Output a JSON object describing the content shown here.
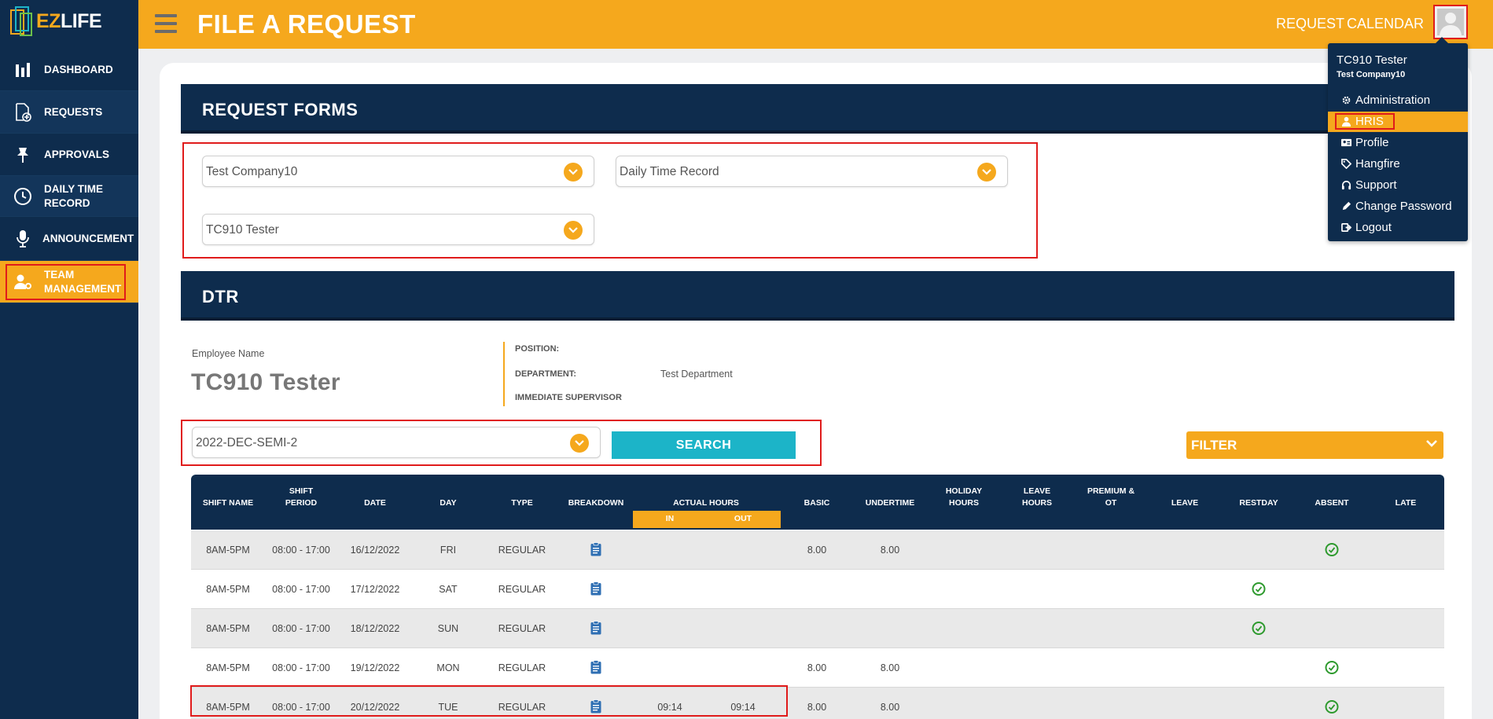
{
  "app": {
    "logo_ez": "EZ",
    "logo_life": "LIFE",
    "page_title": "FILE A REQUEST"
  },
  "sidebar": {
    "items": [
      {
        "label": "DASHBOARD",
        "icon": "bar-chart-icon"
      },
      {
        "label": "REQUESTS",
        "icon": "file-plus-icon"
      },
      {
        "label": "APPROVALS",
        "icon": "pin-icon"
      },
      {
        "label": "DAILY TIME RECORD",
        "icon": "clock-icon"
      },
      {
        "label": "ANNOUNCEMENT",
        "icon": "microphone-icon"
      },
      {
        "label": "TEAM MANAGEMENT",
        "icon": "user-gear-icon"
      }
    ]
  },
  "header": {
    "links": [
      "REQUEST",
      "CALENDAR"
    ]
  },
  "user_menu": {
    "name": "TC910 Tester",
    "company": "Test Company10",
    "items": [
      {
        "label": "Administration",
        "icon": "gear-icon"
      },
      {
        "label": "HRIS",
        "icon": "user-icon"
      },
      {
        "label": "Profile",
        "icon": "id-card-icon"
      },
      {
        "label": "Hangfire",
        "icon": "tags-icon"
      },
      {
        "label": "Support",
        "icon": "headset-icon"
      },
      {
        "label": "Change Password",
        "icon": "pencil-icon"
      },
      {
        "label": "Logout",
        "icon": "logout-icon"
      }
    ]
  },
  "request_forms": {
    "title": "REQUEST FORMS",
    "company_select": "Test Company10",
    "form_select": "Daily Time Record",
    "employee_select": "TC910 Tester"
  },
  "dtr": {
    "title": "DTR",
    "employee_label": "Employee Name",
    "employee_name": "TC910 Tester",
    "position_label": "POSITION:",
    "position_value": "",
    "department_label": "DEPARTMENT:",
    "department_value": "Test Department",
    "supervisor_label": "IMMEDIATE SUPERVISOR",
    "period_select": "2022-DEC-SEMI-2",
    "search_label": "SEARCH",
    "filter_label": "FILTER"
  },
  "table": {
    "headers": {
      "shift_name": "SHIFT NAME",
      "shift_period_1": "SHIFT",
      "shift_period_2": "PERIOD",
      "date": "DATE",
      "day": "DAY",
      "type": "TYPE",
      "breakdown": "BREAKDOWN",
      "actual_hours": "ACTUAL HOURS",
      "in": "IN",
      "out": "OUT",
      "basic": "BASIC",
      "undertime": "UNDERTIME",
      "holiday_1": "HOLIDAY",
      "holiday_2": "HOURS",
      "leave_hours_1": "LEAVE",
      "leave_hours_2": "HOURS",
      "premium_1": "PREMIUM &",
      "premium_2": "OT",
      "leave": "LEAVE",
      "restday": "RESTDAY",
      "absent": "ABSENT",
      "late": "LATE"
    },
    "rows": [
      {
        "shift_name": "8AM-5PM",
        "shift_period": "08:00 - 17:00",
        "date": "16/12/2022",
        "day": "FRI",
        "type": "REGULAR",
        "in": "",
        "out": "",
        "basic": "8.00",
        "undertime": "8.00",
        "restday": false,
        "absent": true
      },
      {
        "shift_name": "8AM-5PM",
        "shift_period": "08:00 - 17:00",
        "date": "17/12/2022",
        "day": "SAT",
        "type": "REGULAR",
        "in": "",
        "out": "",
        "basic": "",
        "undertime": "",
        "restday": true,
        "absent": false
      },
      {
        "shift_name": "8AM-5PM",
        "shift_period": "08:00 - 17:00",
        "date": "18/12/2022",
        "day": "SUN",
        "type": "REGULAR",
        "in": "",
        "out": "",
        "basic": "",
        "undertime": "",
        "restday": true,
        "absent": false
      },
      {
        "shift_name": "8AM-5PM",
        "shift_period": "08:00 - 17:00",
        "date": "19/12/2022",
        "day": "MON",
        "type": "REGULAR",
        "in": "",
        "out": "",
        "basic": "8.00",
        "undertime": "8.00",
        "restday": false,
        "absent": true
      },
      {
        "shift_name": "8AM-5PM",
        "shift_period": "08:00 - 17:00",
        "date": "20/12/2022",
        "day": "TUE",
        "type": "REGULAR",
        "in": "09:14",
        "out": "09:14",
        "basic": "8.00",
        "undertime": "8.00",
        "restday": false,
        "absent": true
      }
    ]
  },
  "colors": {
    "accent": "#f5a81d",
    "navy": "#0e2c4d",
    "search": "#1cb4c8",
    "highlight": "#e01b1b"
  }
}
